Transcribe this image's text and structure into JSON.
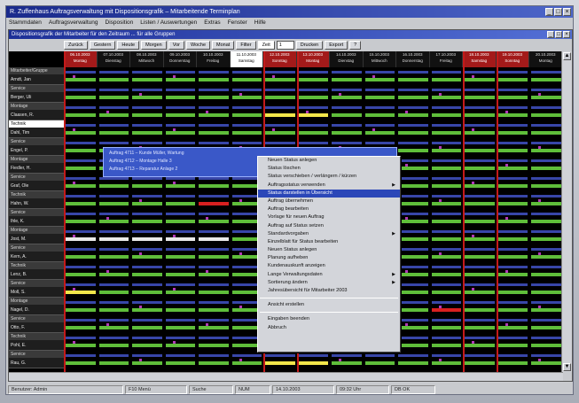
{
  "window": {
    "title": "R. Zuffenhaus Auftragsverwaltung mit Dispositionsgrafik – Mitarbeitende Terminplan",
    "controls": [
      "_",
      "□",
      "×"
    ]
  },
  "menu": [
    "Stammdaten",
    "Auftragsverwaltung",
    "Disposition",
    "Listen / Auswertungen",
    "Extras",
    "Fenster",
    "Hilfe"
  ],
  "inner": {
    "title": "Dispositionsgrafik der Mitarbeiter für den Zeitraum ... für alle Gruppen",
    "controls": [
      "_",
      "□",
      "×"
    ]
  },
  "toolbar": {
    "buttons": [
      "Zurück",
      "Gestern",
      "Heute",
      "Morgen",
      "Vor",
      "Woche",
      "Monat",
      "Filter"
    ],
    "label": "Zeit",
    "select_value": "1",
    "right_buttons": [
      "Drucken",
      "Export",
      "?"
    ]
  },
  "columns": [
    {
      "date": "06.10.2003",
      "day": "Montag",
      "type": "red"
    },
    {
      "date": "07.10.2003",
      "day": "Dienstag",
      "type": "normal"
    },
    {
      "date": "08.10.2003",
      "day": "Mittwoch",
      "type": "normal"
    },
    {
      "date": "09.10.2003",
      "day": "Donnerstag",
      "type": "normal"
    },
    {
      "date": "10.10.2003",
      "day": "Freitag",
      "type": "normal"
    },
    {
      "date": "11.10.2003",
      "day": "Samstag",
      "type": "sel"
    },
    {
      "date": "12.10.2003",
      "day": "Sonntag",
      "type": "red"
    },
    {
      "date": "13.10.2003",
      "day": "Montag",
      "type": "red"
    },
    {
      "date": "14.10.2003",
      "day": "Dienstag",
      "type": "normal"
    },
    {
      "date": "15.10.2003",
      "day": "Mittwoch",
      "type": "normal"
    },
    {
      "date": "16.10.2003",
      "day": "Donnerstag",
      "type": "normal"
    },
    {
      "date": "17.10.2003",
      "day": "Freitag",
      "type": "normal"
    },
    {
      "date": "18.10.2003",
      "day": "Samstag",
      "type": "red"
    },
    {
      "date": "19.10.2003",
      "day": "Sonntag",
      "type": "red"
    },
    {
      "date": "20.10.2003",
      "day": "Montag",
      "type": "normal"
    }
  ],
  "rows": [
    {
      "group": "Mitarbeiter/Gruppe",
      "name": "Arndt, Jan"
    },
    {
      "group": "Service",
      "name": "Berger, Uli"
    },
    {
      "group": "Montage",
      "name": "Claasen, R."
    },
    {
      "group": "Technik",
      "name": "Dahl, Tim"
    },
    {
      "group": "Service",
      "name": "Engel, P."
    },
    {
      "group": "Montage",
      "name": "Fiedler, H."
    },
    {
      "group": "Service",
      "name": "Graf, Ole"
    },
    {
      "group": "Technik",
      "name": "Hahn, W."
    },
    {
      "group": "Service",
      "name": "Ihle, K."
    },
    {
      "group": "Montage",
      "name": "Jost, M."
    },
    {
      "group": "Service",
      "name": "Kern, A."
    },
    {
      "group": "Technik",
      "name": "Lenz, B."
    },
    {
      "group": "Service",
      "name": "Moll, S."
    },
    {
      "group": "Montage",
      "name": "Nagel, D."
    },
    {
      "group": "Service",
      "name": "Otto, F."
    },
    {
      "group": "Technik",
      "name": "Pohl, E."
    },
    {
      "group": "Service",
      "name": "Rau, G."
    }
  ],
  "selection_text": [
    "Auftrag 4711 – Kunde Müller, Wartung",
    "Auftrag 4712 – Montage Halle 3",
    "Auftrag 4713 – Reparatur Anlage 2"
  ],
  "context_menu": [
    {
      "label": "Neuen Status anlegen",
      "sub": false
    },
    {
      "label": "Status löschen",
      "sub": false
    },
    {
      "label": "Status verschieben / verlängern / kürzen",
      "sub": false
    },
    {
      "label": "Auftragsstatus verwenden",
      "sub": true
    },
    {
      "label": "Status darstellen in Übersicht",
      "sub": false,
      "highlight": true
    },
    {
      "label": "Auftrag übernehmen",
      "sub": false
    },
    {
      "label": "Auftrag bearbeiten",
      "sub": false
    },
    {
      "label": "Vorlage für neuen Auftrag",
      "sub": false
    },
    {
      "label": "Auftrag auf Status setzen",
      "sub": false
    },
    {
      "label": "Standardvorgaben",
      "sub": true
    },
    {
      "label": "Einzelblatt für Status bearbeiten",
      "sub": false
    },
    {
      "label": "Neuen Status anlegen",
      "sub": false
    },
    {
      "label": "Planung aufheben",
      "sub": false
    },
    {
      "label": "Kundenauskunft anzeigen",
      "sub": false
    },
    {
      "label": "Lange Verwaltungsdaten",
      "sub": true
    },
    {
      "label": "Sortierung ändern",
      "sub": true
    },
    {
      "label": "Jahresübersicht für Mitarbeiter 2003",
      "sub": false
    },
    {
      "label": "Ansicht erstellen",
      "sub": false,
      "sep_before": true
    },
    {
      "label": "Eingaben beenden",
      "sub": false,
      "sep_before": true
    },
    {
      "label": "Abbruch",
      "sub": false
    }
  ],
  "status": {
    "left": "Benutzer: Admin",
    "panels": [
      "F10 Menü",
      "Suche",
      "NUM",
      "14.10.2003",
      "09:32 Uhr",
      "DB OK"
    ]
  }
}
